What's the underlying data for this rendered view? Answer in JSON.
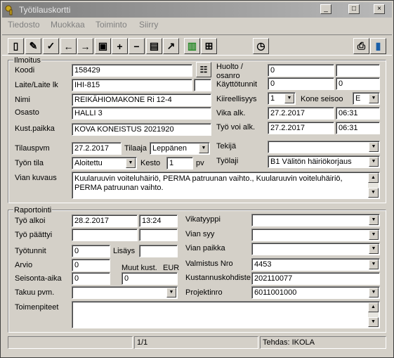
{
  "window": {
    "title": "Työtilauskortti",
    "minimize": "_",
    "maximize": "□",
    "close": "×"
  },
  "menu": [
    "Tiedosto",
    "Muokkaa",
    "Toiminto",
    "Siirry"
  ],
  "toolbar": {
    "icons": [
      "open-icon",
      "edit-icon",
      "edit-check-icon",
      "arrow-left-icon",
      "arrow-right-icon",
      "save-icon",
      "plus-icon",
      "minus-icon",
      "delete-icon",
      "export-icon",
      "green-book-icon",
      "ruler-icon",
      "clock-icon",
      "print-icon",
      "exit-door-icon"
    ],
    "glyphs": [
      "▯",
      "✎",
      "✓",
      "←",
      "→",
      "▣",
      "+",
      "−",
      "▤",
      "↗",
      "▥",
      "⊞",
      "◷",
      "⎙",
      "▮"
    ]
  },
  "ilmoitus": {
    "section": "Ilmoitus",
    "koodi_label": "Koodi",
    "koodi": "158429",
    "laite_label": "Laite/Laite lk",
    "laite": "IHI-815",
    "laite_lk": "",
    "nimi_label": "Nimi",
    "nimi": "REIKÄHIOMAKONE Ri 12-4",
    "osasto_label": "Osasto",
    "osasto": "HALLI 3",
    "kustpaikka_label": "Kust.paikka",
    "kustpaikka": "KOVA KONEISTUS 2021920",
    "huolto_label": "Huolto /",
    "osanro_label": "osanro",
    "huolto1": "0",
    "huolto2": "",
    "kayttotunnit_label": "Käyttötunnit",
    "kayttotunnit1": "0",
    "kayttotunnit2": "0",
    "kiireellisyys_label": "Kiireellisyys",
    "kiireellisyys": "1",
    "koneseisoo_label": "Kone seisoo",
    "koneseisoo": "E",
    "vikaalk_label": "Vika alk.",
    "vikaalk_pvm": "27.2.2017",
    "vikaalk_aika": "06:31",
    "tyovoialk_label": "Työ voi alk.",
    "tyovoialk_pvm": "27.2.2017",
    "tyovoialk_aika": "06:31",
    "tilauspvm_label": "Tilauspvm",
    "tilauspvm": "27.2.2017",
    "tilaaja_label": "Tilaaja",
    "tilaaja": "Leppänen",
    "tekija_label": "Tekijä",
    "tekija": "",
    "tyontila_label": "Työn tila",
    "tyontila": "Aloitettu",
    "kesto_label": "Kesto",
    "kesto": "1",
    "kesto_unit": "pv",
    "tyolaji_label": "Työlaji",
    "tyolaji": "B1 Välitön häiriökorjaus",
    "viankuvaus_label": "Vian kuvaus",
    "viankuvaus": "Kuularuuvin voiteluhäiriö, PERMA patruunan vaihto., Kuularuuvin voiteluhäiriö, PERMA patruunan vaihto."
  },
  "raportointi": {
    "section": "Raportointi",
    "tyoalkoi_label": "Työ alkoi",
    "tyoalkoi_pvm": "28.2.2017",
    "tyoalkoi_aika": "13:24",
    "tyopaattyi_label": "Työ päättyi",
    "tyopaattyi_pvm": "",
    "tyopaattyi_aika": "",
    "tyotunnit_label": "Työtunnit",
    "tyotunnit": "0",
    "lisays_label": "Lisäys",
    "lisays": "",
    "arvio_label": "Arvio",
    "arvio": "0",
    "muutkust_label": "Muut kust.",
    "eur_label": "EUR",
    "seisonta_label": "Seisonta-aika",
    "seisonta": "0",
    "muutkust": "0",
    "takuu_label": "Takuu pvm.",
    "takuu": "",
    "toimenpiteet_label": "Toimenpiteet",
    "toimenpiteet": "",
    "vikatyyppi_label": "Vikatyyppi",
    "vikatyyppi": "",
    "viansyy_label": "Vian syy",
    "viansyy": "",
    "vianpaikka_label": "Vian paikka",
    "vianpaikka": "",
    "valmistus_label": "Valmistus Nro",
    "valmistus": "4453",
    "kustkohdiste_label": "Kustannuskohdiste",
    "kustkohdiste": "202110077",
    "projektinro_label": "Projektinro",
    "projektinro": "6011001000"
  },
  "status": {
    "left": "",
    "page": "1/1",
    "factory": "Tehdas: IKOLA"
  }
}
